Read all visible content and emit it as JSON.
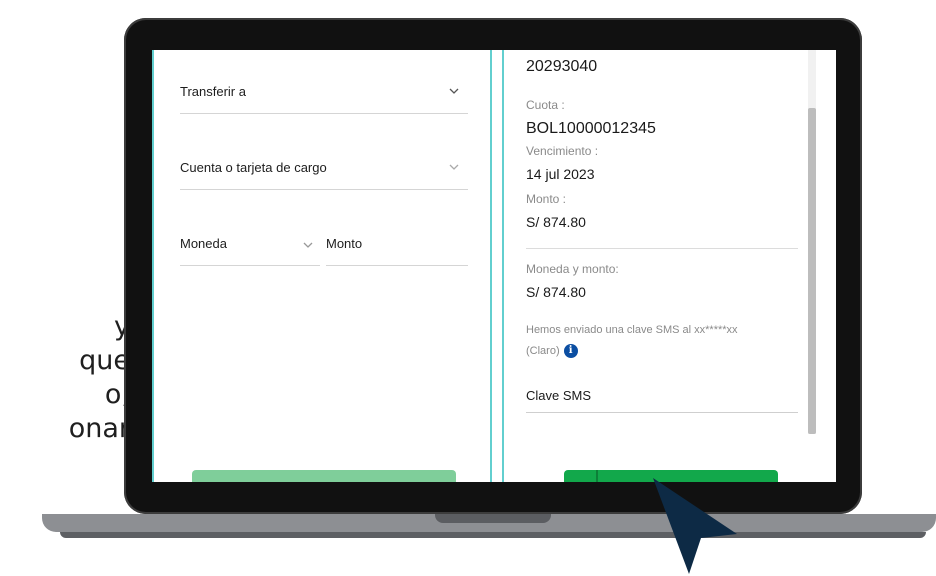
{
  "caption": {
    "lines": [
      "y",
      "que",
      "o,",
      "onar"
    ]
  },
  "transfer_form": {
    "transfer_to": "Transferir a",
    "charge_account": "Cuenta o tarjeta de cargo",
    "currency": "Moneda",
    "amount": "Monto"
  },
  "summary": {
    "top_value": "20293040",
    "quota_label": "Cuota :",
    "quota_value": "BOL10000012345",
    "due_label": "Vencimiento :",
    "due_value": "14 jul 2023",
    "amount_label": "Monto :",
    "amount_value": "S/ 874.80",
    "currency_amount_label": "Moneda y monto:",
    "currency_amount_value": "S/ 874.80",
    "sms_notice_line1": "Hemos enviado una clave SMS al xx*****xx",
    "sms_notice_line2": "(Claro)",
    "sms_field_label": "Clave SMS"
  },
  "colors": {
    "panel_border": "#62cfcf",
    "left_button": "#7fce9a",
    "right_button": "#12a84b",
    "info_icon": "#0b4ea2",
    "cursor": "#0d2a45"
  },
  "icons": [
    "chevron-down-icon",
    "info-icon",
    "mouse-cursor-icon"
  ]
}
